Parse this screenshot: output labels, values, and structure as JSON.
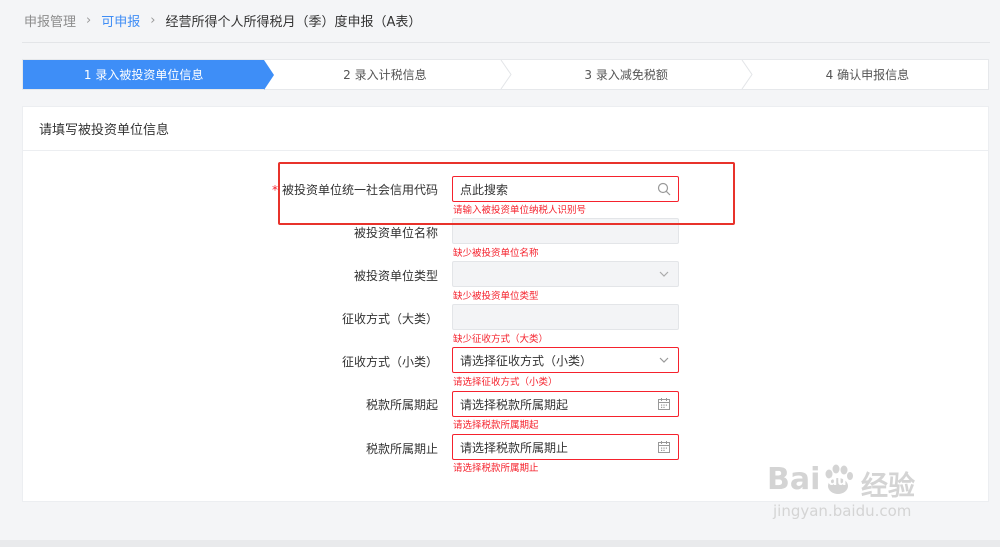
{
  "breadcrumb": {
    "root": "申报管理",
    "parent": "可申报",
    "current": "经营所得个人所得税月（季）度申报（A表）"
  },
  "steps": [
    {
      "label": "1 录入被投资单位信息",
      "active": true
    },
    {
      "label": "2 录入计税信息",
      "active": false
    },
    {
      "label": "3 录入减免税额",
      "active": false
    },
    {
      "label": "4 确认申报信息",
      "active": false
    }
  ],
  "panel": {
    "title": "请填写被投资单位信息"
  },
  "form": {
    "credit_code": {
      "required_mark": "*",
      "label": "被投资单位统一社会信用代码",
      "value": "点此搜索",
      "error": "请输入被投资单位纳税人识别号",
      "icon": "search-icon"
    },
    "unit_name": {
      "label": "被投资单位名称",
      "value": "",
      "error": "缺少被投资单位名称"
    },
    "unit_type": {
      "label": "被投资单位类型",
      "value": "",
      "error": "缺少被投资单位类型",
      "icon": "chevron-down-icon"
    },
    "levy_major": {
      "label": "征收方式（大类）",
      "value": "",
      "error": "缺少征收方式（大类）"
    },
    "levy_minor": {
      "label": "征收方式（小类）",
      "value": "请选择征收方式（小类）",
      "error": "请选择征收方式（小类）",
      "icon": "chevron-down-icon"
    },
    "period_start": {
      "label": "税款所属期起",
      "value": "请选择税款所属期起",
      "error": "请选择税款所属期起",
      "icon": "calendar-icon"
    },
    "period_end": {
      "label": "税款所属期止",
      "value": "请选择税款所属期止",
      "error": "请选择税款所属期止",
      "icon": "calendar-icon"
    }
  },
  "watermark": {
    "brand": "Bai",
    "brand_du": "du",
    "suffix": "经验",
    "url": "jingyan.baidu.com"
  },
  "colors": {
    "accent": "#3e8ef7",
    "error": "#f5222d",
    "highlight": "#e8322b"
  }
}
